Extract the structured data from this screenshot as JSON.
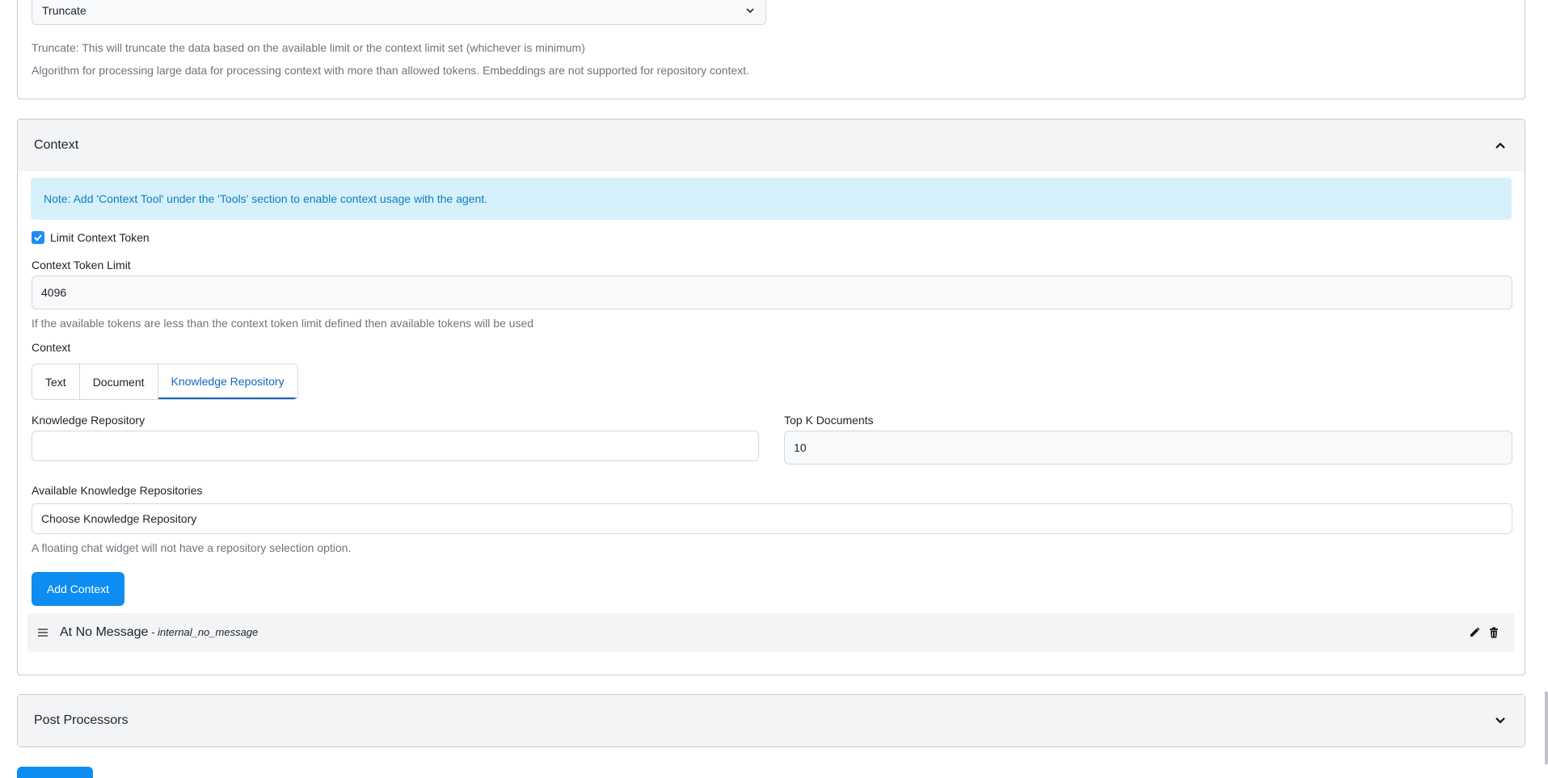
{
  "processing": {
    "algorithm_value": "Truncate",
    "truncate_help": "Truncate: This will truncate the data based on the available limit or the context limit set (whichever is minimum)",
    "algorithm_help": "Algorithm for processing large data for processing context with more than allowed tokens. Embeddings are not supported for repository context."
  },
  "context_section": {
    "title": "Context",
    "note": "Note: Add 'Context Tool' under the 'Tools' section to enable context usage with the agent.",
    "limit_checkbox_label": "Limit Context Token",
    "limit_checked": true,
    "token_limit_label": "Context Token Limit",
    "token_limit_value": "4096",
    "token_limit_help": "If the available tokens are less than the context token limit defined then available tokens will be used",
    "context_label": "Context",
    "tabs": [
      "Text",
      "Document",
      "Knowledge Repository"
    ],
    "active_tab": "Knowledge Repository",
    "knowledge_repo_label": "Knowledge Repository",
    "knowledge_repo_value": "",
    "top_k_label": "Top K Documents",
    "top_k_value": "10",
    "available_label": "Available Knowledge Repositories",
    "available_value": "Choose Knowledge Repository",
    "widget_help": "A floating chat widget will not have a repository selection option.",
    "add_button": "Add Context",
    "items": [
      {
        "title": "At No Message",
        "separator": " - ",
        "key": "internal_no_message"
      }
    ]
  },
  "post_processors": {
    "title": "Post Processors"
  },
  "colors": {
    "primary": "#0d8df2",
    "note_bg": "#d7f1fc",
    "note_text": "#0b7fc2",
    "header_bg": "#f3f4f6"
  }
}
